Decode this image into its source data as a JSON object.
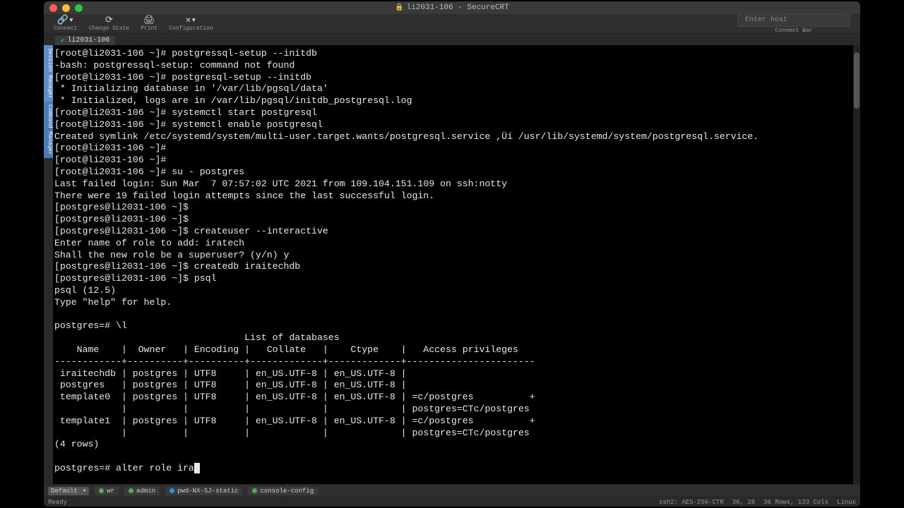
{
  "window": {
    "title": "li2031-106 - SecureCRT"
  },
  "toolbar": {
    "connect": "Connect",
    "change_state": "Change State",
    "print": "Print",
    "configuration": "Configuration",
    "enter_host_placeholder": "Enter host",
    "connect_bar": "Connect Bar"
  },
  "tab": {
    "label": "li2031-106"
  },
  "sidebar": {
    "session_manager": "Session Manager",
    "command_manager": "Command Manager"
  },
  "terminal_lines": [
    "[root@li2031-106 ~]# postgressql-setup --initdb",
    "-bash: postgressql-setup: command not found",
    "[root@li2031-106 ~]# postgresql-setup --initdb",
    " * Initializing database in '/var/lib/pgsql/data'",
    " * Initialized, logs are in /var/lib/pgsql/initdb_postgresql.log",
    "[root@li2031-106 ~]# systemctl start postgresql",
    "[root@li2031-106 ~]# systemctl enable postgresql",
    "Created symlink /etc/systemd/system/multi-user.target.wants/postgresql.service ,Üí /usr/lib/systemd/system/postgresql.service.",
    "[root@li2031-106 ~]#",
    "[root@li2031-106 ~]#",
    "[root@li2031-106 ~]# su - postgres",
    "Last failed login: Sun Mar  7 07:57:02 UTC 2021 from 109.104.151.109 on ssh:notty",
    "There were 19 failed login attempts since the last successful login.",
    "[postgres@li2031-106 ~]$",
    "[postgres@li2031-106 ~]$",
    "[postgres@li2031-106 ~]$ createuser --interactive",
    "Enter name of role to add: iratech",
    "Shall the new role be a superuser? (y/n) y",
    "[postgres@li2031-106 ~]$ createdb iraitechdb",
    "[postgres@li2031-106 ~]$ psql",
    "psql (12.5)",
    "Type \"help\" for help.",
    "",
    "postgres=# \\l",
    "                                  List of databases",
    "    Name    |  Owner   | Encoding |   Collate   |    Ctype    |   Access privileges",
    "------------+----------+----------+-------------+-------------+-----------------------",
    " iraitechdb | postgres | UTF8     | en_US.UTF-8 | en_US.UTF-8 |",
    " postgres   | postgres | UTF8     | en_US.UTF-8 | en_US.UTF-8 |",
    " template0  | postgres | UTF8     | en_US.UTF-8 | en_US.UTF-8 | =c/postgres          +",
    "            |          |          |             |             | postgres=CTc/postgres",
    " template1  | postgres | UTF8     | en_US.UTF-8 | en_US.UTF-8 | =c/postgres          +",
    "            |          |          |             |             | postgres=CTc/postgres",
    "(4 rows)",
    ""
  ],
  "terminal_prompt": "postgres=# alter role ira",
  "button_bar": {
    "default": "Default",
    "items": [
      {
        "label": "wr",
        "color": "green"
      },
      {
        "label": "admin",
        "color": "green"
      },
      {
        "label": "pwd-NX-SJ-static",
        "color": "blue"
      },
      {
        "label": "console-config",
        "color": "green"
      }
    ]
  },
  "status": {
    "ready": "Ready",
    "proto": "ssh2: AES-256-CTR",
    "pos": "36, 28",
    "size": "36 Rows, 133 Cols",
    "os": "Linux"
  }
}
